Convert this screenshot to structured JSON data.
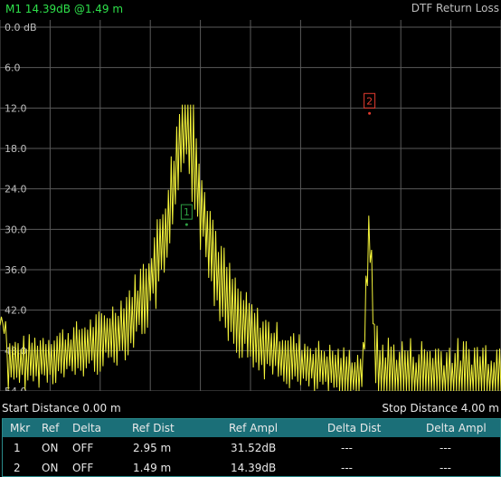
{
  "top": {
    "marker_readout": "M1 14.39dB @1.49 m",
    "mode_title": "DTF Return Loss"
  },
  "chart_data": {
    "type": "line",
    "ylabel_ticks": [
      "0.0 dB",
      "6.0",
      "12.0",
      "18.0",
      "24.0",
      "30.0",
      "36.0",
      "42.0",
      "48.0",
      "54.0"
    ],
    "ylim": [
      0,
      54
    ],
    "xlim": [
      0,
      4
    ],
    "x_unit": "m",
    "grid": true,
    "trace_color": "#f4f43a",
    "markers": [
      {
        "label": "2",
        "x": 2.95,
        "y": 12.8,
        "color": "#e23b2e"
      },
      {
        "label": "1",
        "x": 1.49,
        "y": 29.3,
        "color": "#2ea043"
      }
    ]
  },
  "distance": {
    "start": "Start Distance 0.00 m",
    "stop": "Stop Distance 4.00 m"
  },
  "marker_table": {
    "headers": [
      "Mkr",
      "Ref",
      "Delta",
      "Ref Dist",
      "Ref Ampl",
      "Delta Dist",
      "Delta Ampl"
    ],
    "rows": [
      [
        "1",
        "ON",
        "OFF",
        "2.95 m",
        "31.52dB",
        "---",
        "---"
      ],
      [
        "2",
        "ON",
        "OFF",
        "1.49 m",
        "14.39dB",
        "---",
        "---"
      ]
    ]
  }
}
